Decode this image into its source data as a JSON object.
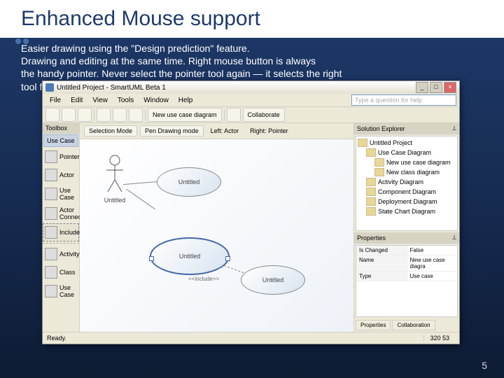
{
  "slide": {
    "title": "Enhanced Mouse support",
    "subtitle_l1": "Easier drawing using the \"Design prediction\" feature.",
    "subtitle_l2": "Drawing and editing at the same time. Right mouse button is always",
    "subtitle_l3": "the handy pointer. Never select the pointer tool again — it selects the right",
    "subtitle_l4": "tool for you",
    "page_number": "5"
  },
  "app": {
    "window_title": "Untitled Project - SmartUML Beta 1",
    "ask_placeholder": "Type a question for help",
    "menu": [
      "File",
      "Edit",
      "View",
      "Tools",
      "Window",
      "Help"
    ],
    "toolbar_btn_new": "New use case diagram",
    "toolbar_btn_collab": "Collaborate",
    "toolbox_header": "Toolbox",
    "toolbox_category": "Use Case",
    "toolbox_items": [
      "Pointer",
      "Actor",
      "Use Case",
      "Actor Connector",
      "Includes"
    ],
    "toolbox_more": [
      "Activity",
      "Class",
      "Use Case"
    ],
    "canvas_tools": {
      "selection": "Selection Mode",
      "pen": "Pen Drawing mode",
      "left": "Left: Actor",
      "right": "Right: Pointer"
    },
    "shapes": {
      "actor_label": "Untitled",
      "e1": "Untitled",
      "e2": "Untitled",
      "e3": "Untitled",
      "include": "<<include>>"
    },
    "solution_explorer": {
      "header": "Solution Explorer",
      "root": "Untitled Project",
      "item_usecase": "Use Case Diagram",
      "item_new_usecase": "New use case diagram",
      "item_new_class": "New class diagram",
      "item_activity": "Activity Diagram",
      "item_component": "Component Diagram",
      "item_deployment": "Deployment Diagram",
      "item_statechart": "State Chart Diagram"
    },
    "properties": {
      "header": "Properties",
      "rows": [
        {
          "k": "Is Changed",
          "v": "False"
        },
        {
          "k": "Name",
          "v": "New use case diagra"
        },
        {
          "k": "Type",
          "v": "Use case"
        }
      ],
      "tab_props": "Properties",
      "tab_collab": "Collaboration"
    },
    "status_ready": "Ready.",
    "status_coords": "320 53"
  }
}
